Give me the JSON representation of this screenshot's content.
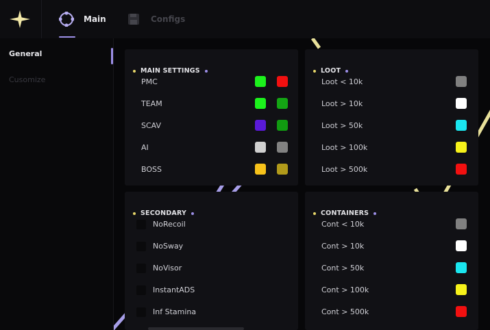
{
  "tabs": [
    {
      "label": "Main",
      "icon": "crosshair-icon"
    },
    {
      "label": "Configs",
      "icon": "save-icon"
    }
  ],
  "sidebar": {
    "items": [
      {
        "label": "General"
      },
      {
        "label": "Cusomize"
      }
    ]
  },
  "panels": {
    "main_settings": {
      "title": "MAIN SETTINGS",
      "rows": [
        {
          "label": "PMC",
          "color1": "#1cf21c",
          "color2": "#f21010"
        },
        {
          "label": "TEAM",
          "color1": "#1cf21c",
          "color2": "#14a514"
        },
        {
          "label": "SCAV",
          "color1": "#5a1ad8",
          "color2": "#119a11"
        },
        {
          "label": "AI",
          "color1": "#d0d0d0",
          "color2": "#828282"
        },
        {
          "label": "BOSS",
          "color1": "#f7c21a",
          "color2": "#b19a1a"
        }
      ]
    },
    "loot": {
      "title": "LOOT",
      "rows": [
        {
          "label": "Loot < 10k",
          "color": "#808080"
        },
        {
          "label": "Loot > 10k",
          "color": "#ffffff"
        },
        {
          "label": "Loot > 50k",
          "color": "#1ae6ef"
        },
        {
          "label": "Loot > 100k",
          "color": "#f7f21a"
        },
        {
          "label": "Loot > 500k",
          "color": "#f21010"
        }
      ]
    },
    "secondary": {
      "title": "SECONDARY",
      "rows": [
        {
          "label": "NoRecoil"
        },
        {
          "label": "NoSway"
        },
        {
          "label": "NoVisor"
        },
        {
          "label": "InstantADS"
        },
        {
          "label": "Inf Stamina"
        }
      ]
    },
    "containers": {
      "title": "CONTAINERS",
      "rows": [
        {
          "label": "Cont < 10k",
          "color": "#808080"
        },
        {
          "label": "Cont > 10k",
          "color": "#ffffff"
        },
        {
          "label": "Cont > 50k",
          "color": "#1ae6ef"
        },
        {
          "label": "Cont > 100k",
          "color": "#f7f21a"
        },
        {
          "label": "Cont > 500k",
          "color": "#f21010"
        }
      ]
    }
  },
  "colors": {
    "accent_purple": "#9d8fe8",
    "accent_yellow": "#e8d86a"
  }
}
